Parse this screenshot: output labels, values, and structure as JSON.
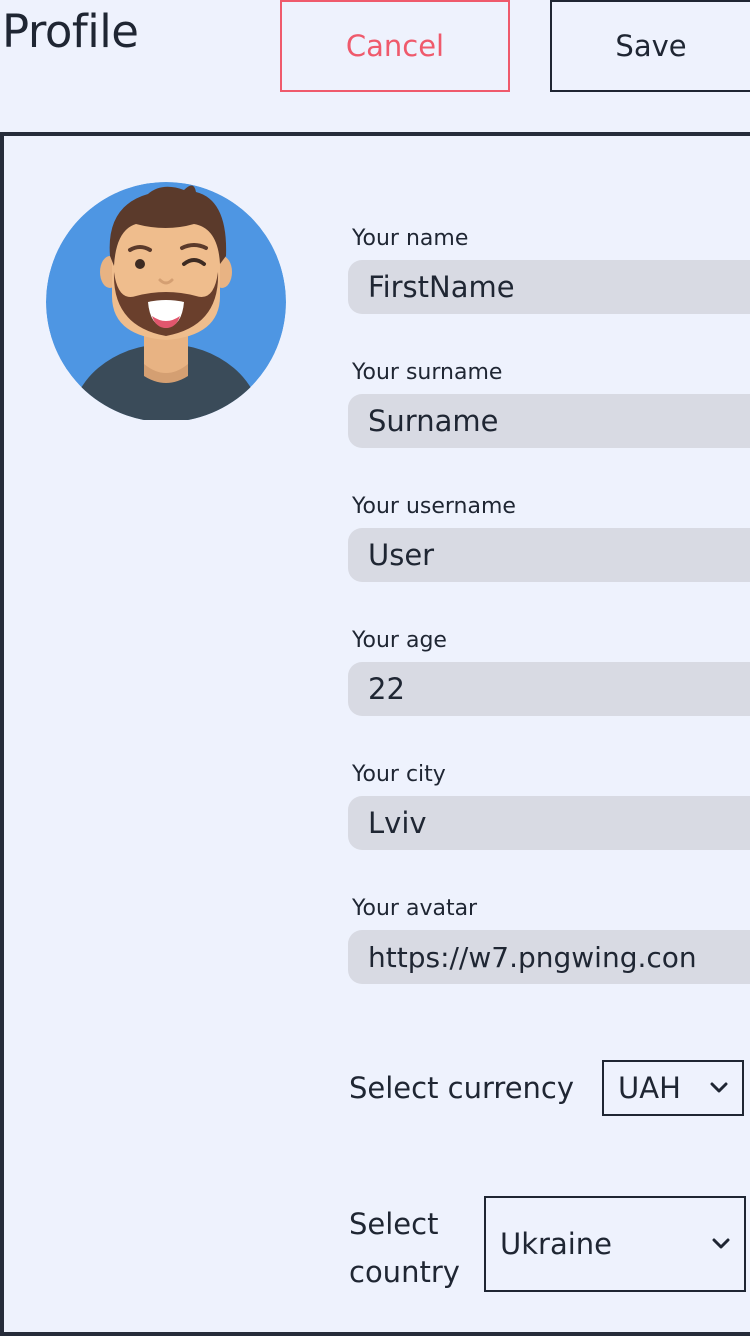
{
  "header": {
    "title": "Profile",
    "cancel_label": "Cancel",
    "save_label": "Save"
  },
  "profile": {
    "avatar_icon": "avatar-man-beard-winking",
    "fields": [
      {
        "label": "Your name",
        "value": "FirstName"
      },
      {
        "label": "Your surname",
        "value": "Surname"
      },
      {
        "label": "Your username",
        "value": "User"
      },
      {
        "label": "Your age",
        "value": "22"
      },
      {
        "label": "Your city",
        "value": "Lviv"
      },
      {
        "label": "Your avatar",
        "value": "https://w7.pngwing.con"
      }
    ],
    "currency": {
      "label": "Select currency",
      "selected": "UAH"
    },
    "country": {
      "label_line1": "Select",
      "label_line2": "country",
      "selected": "Ukraine"
    }
  },
  "colors": {
    "background": "#eef2fd",
    "cancel_accent": "#ef5a6c",
    "text": "#1f2633",
    "input_bg": "#d8dae3",
    "avatar_bg": "#4e96e3"
  }
}
